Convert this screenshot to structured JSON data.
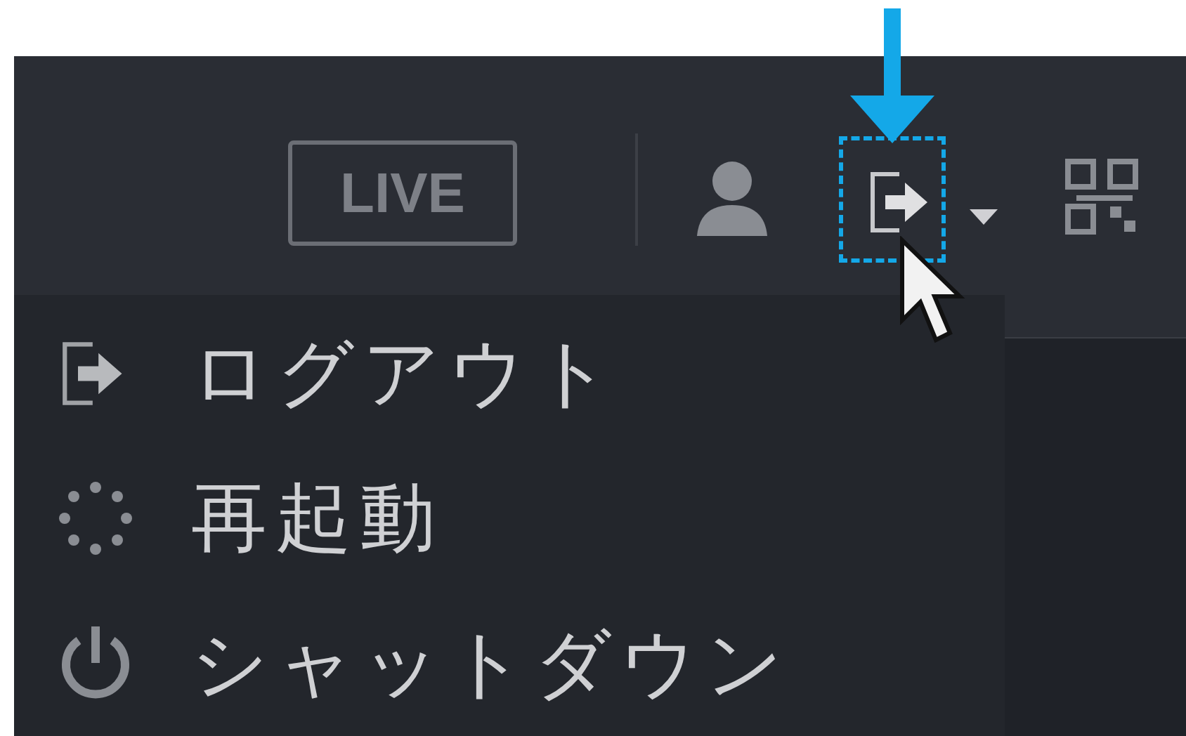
{
  "header": {
    "live_button": "LIVE"
  },
  "menu": {
    "items": [
      {
        "label": "ログアウト"
      },
      {
        "label": "再起動"
      },
      {
        "label": "シャットダウン"
      }
    ]
  }
}
